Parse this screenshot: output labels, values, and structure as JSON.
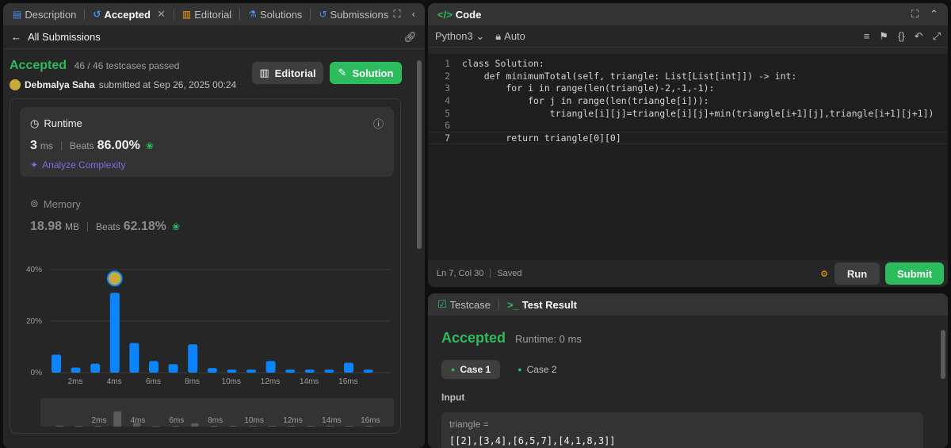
{
  "left_tabs": [
    {
      "label": "Description",
      "icon": "description-icon"
    },
    {
      "label": "Accepted",
      "icon": "history-icon"
    },
    {
      "label": "Editorial",
      "icon": "book-icon"
    },
    {
      "label": "Solutions",
      "icon": "flask-icon"
    },
    {
      "label": "Submissions",
      "icon": "history-icon"
    }
  ],
  "subbar": {
    "back_label": "All Submissions"
  },
  "submission": {
    "status": "Accepted",
    "testcases": "46 / 46 testcases passed",
    "author": "Debmalya Saha",
    "submitted": "submitted at Sep 26, 2025 00:24",
    "editorial_label": "Editorial",
    "solution_label": "Solution"
  },
  "runtime": {
    "title": "Runtime",
    "value": "3",
    "unit": "ms",
    "beats_label": "Beats",
    "beats_pct": "86.00%",
    "analyze_label": "Analyze Complexity"
  },
  "memory": {
    "title": "Memory",
    "value": "18.98",
    "unit": "MB",
    "beats_label": "Beats",
    "beats_pct": "62.18%"
  },
  "chart_data": {
    "type": "bar",
    "x": [
      1,
      2,
      3,
      4,
      5,
      6,
      7,
      8,
      9,
      10,
      11,
      12,
      13,
      14,
      15,
      16
    ],
    "values": [
      7,
      2,
      3.5,
      31,
      11.5,
      4.5,
      3.3,
      11,
      1.8,
      1.2,
      1.2,
      4.5,
      1.2,
      1.2,
      1.2,
      3.8,
      1.2
    ],
    "xticks": [
      "2ms",
      "4ms",
      "6ms",
      "8ms",
      "10ms",
      "12ms",
      "14ms",
      "16ms"
    ],
    "yticks": [
      "0%",
      "20%",
      "40%"
    ],
    "ylim": [
      0,
      40
    ],
    "highlight_index": 3,
    "color": "#0a84ff",
    "mini_ticks": [
      "2ms",
      "4ms",
      "6ms",
      "8ms",
      "10ms",
      "12ms",
      "14ms",
      "16ms"
    ]
  },
  "code": {
    "title": "Code",
    "language": "Python3",
    "mode": "Auto",
    "lines": [
      "class Solution:",
      "    def minimumTotal(self, triangle: List[List[int]]) -> int:",
      "        for i in range(len(triangle)-2,-1,-1):",
      "            for j in range(len(triangle[i])):",
      "                triangle[i][j]=triangle[i][j]+min(triangle[i+1][j],triangle[i+1][j+1])",
      "",
      "        return triangle[0][0]"
    ],
    "position": "Ln 7, Col 30",
    "saved": "Saved",
    "run_label": "Run",
    "submit_label": "Submit"
  },
  "result": {
    "tab_testcase": "Testcase",
    "tab_result": "Test Result",
    "status": "Accepted",
    "runtime": "Runtime: 0 ms",
    "cases": [
      "Case 1",
      "Case 2"
    ],
    "input_label": "Input",
    "input_name": "triangle =",
    "input_value": "[[2],[3,4],[6,5,7],[4,1,8,3]]"
  },
  "colors": {
    "accent_green": "#2cbb5d",
    "bar_blue": "#0a84ff",
    "purple": "#7f6ce6"
  }
}
